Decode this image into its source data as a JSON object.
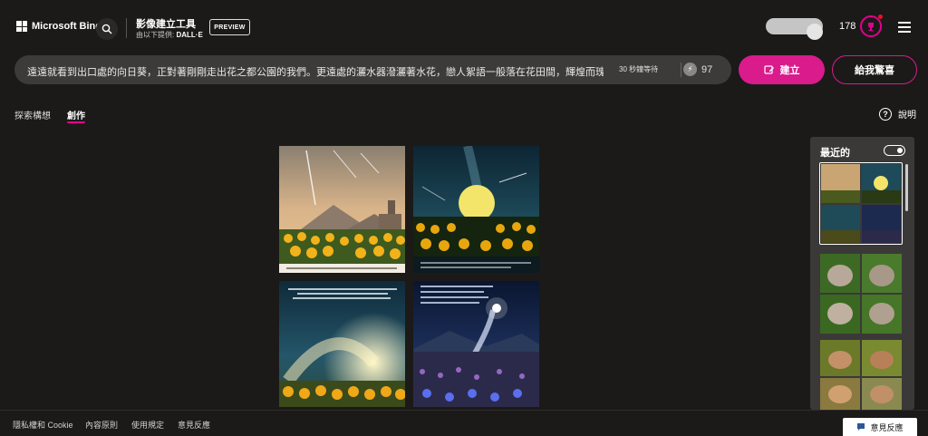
{
  "header": {
    "brand": "Microsoft Bing",
    "app_title": "影像建立工具",
    "subtitle_prefix": "由以下提供:",
    "subtitle_provider": "DALL·E",
    "preview_badge": "PREVIEW",
    "coins": "178"
  },
  "prompt": {
    "text": "遠遠就看到出口處的向日葵，正對著剛剛走出花之都公園的我們。更遠處的灑水器潑灑著水花，戀人絮語一般落在花田間，輝煌而瑰麗",
    "wait_text": "30 秒鐘等待",
    "boost_count": "97"
  },
  "buttons": {
    "create": "建立",
    "surprise": "給我驚喜"
  },
  "tabs": {
    "explore": "探索構想",
    "create": "創作"
  },
  "help": {
    "label": "說明"
  },
  "recent": {
    "title": "最近的"
  },
  "footer": {
    "privacy": "隱私權和 Cookie",
    "content_policy": "內容原則",
    "terms": "使用規定",
    "feedback_link": "意見反應",
    "feedback_button": "意見反應"
  },
  "colors": {
    "accent": "#d91b8c",
    "background": "#1b1a19",
    "prompt_bg": "#3c3b3a"
  }
}
